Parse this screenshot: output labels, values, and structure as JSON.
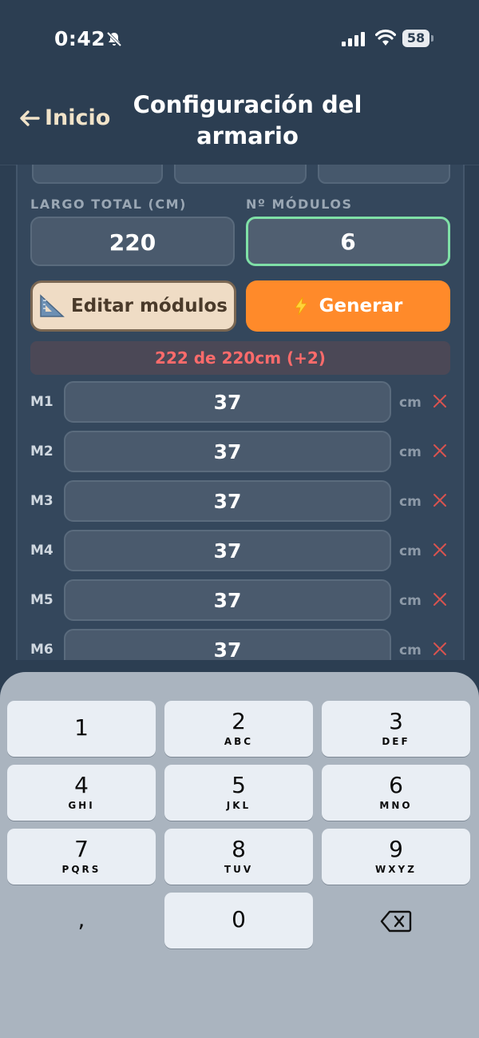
{
  "status_bar": {
    "time": "0:42",
    "battery": "58"
  },
  "header": {
    "back_label": "Inicio",
    "title": "Configuración del armario"
  },
  "form": {
    "largo_label": "LARGO TOTAL (CM)",
    "largo_value": "220",
    "modulos_label": "Nº MÓDULOS",
    "modulos_value": "6",
    "edit_button": "Editar módulos",
    "generate_button": "Generar",
    "warning": "222 de 220cm (+2)"
  },
  "modules": [
    {
      "label": "M1",
      "value": "37",
      "unit": "cm"
    },
    {
      "label": "M2",
      "value": "37",
      "unit": "cm"
    },
    {
      "label": "M3",
      "value": "37",
      "unit": "cm"
    },
    {
      "label": "M4",
      "value": "37",
      "unit": "cm"
    },
    {
      "label": "M5",
      "value": "37",
      "unit": "cm"
    },
    {
      "label": "M6",
      "value": "37",
      "unit": "cm"
    }
  ],
  "keyboard": {
    "keys": [
      {
        "num": "1",
        "sub": ""
      },
      {
        "num": "2",
        "sub": "ABC"
      },
      {
        "num": "3",
        "sub": "DEF"
      },
      {
        "num": "4",
        "sub": "GHI"
      },
      {
        "num": "5",
        "sub": "JKL"
      },
      {
        "num": "6",
        "sub": "MNO"
      },
      {
        "num": "7",
        "sub": "PQRS"
      },
      {
        "num": "8",
        "sub": "TUV"
      },
      {
        "num": "9",
        "sub": "WXYZ"
      },
      {
        "num": ",",
        "sub": ""
      },
      {
        "num": "0",
        "sub": ""
      }
    ]
  },
  "colors": {
    "accent": "#ff8a2a",
    "focus": "#7fe0a7",
    "warning": "#ff6b6b",
    "edit": "#efdcc5"
  }
}
